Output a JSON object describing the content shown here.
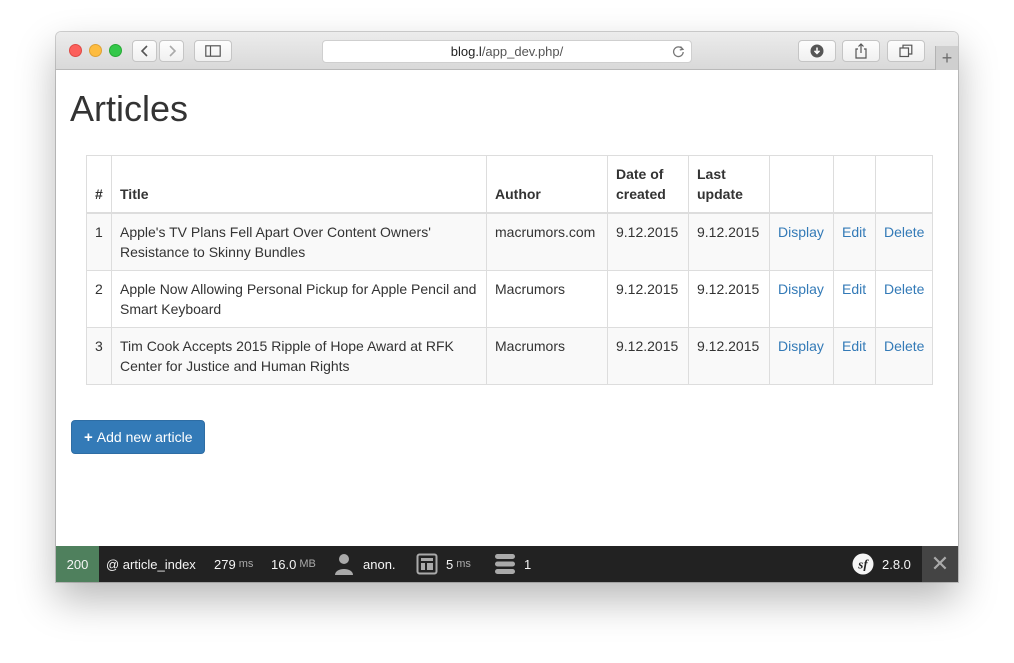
{
  "browser": {
    "url_host": "blog.l",
    "url_path": "/app_dev.php/"
  },
  "page": {
    "title": "Articles"
  },
  "table": {
    "headers": {
      "num": "#",
      "title": "Title",
      "author": "Author",
      "created_1": "Date of",
      "created_2": "created",
      "updated_1": "Last",
      "updated_2": "update"
    },
    "rows": [
      {
        "num": "1",
        "title": "Apple's TV Plans Fell Apart Over Content Owners' Resistance to Skinny Bundles",
        "author": "macrumors.com",
        "created": "9.12.2015",
        "updated": "9.12.2015",
        "display": "Display",
        "edit": "Edit",
        "delete": "Delete"
      },
      {
        "num": "2",
        "title": "Apple Now Allowing Personal Pickup for Apple Pencil and Smart Keyboard",
        "author": "Macrumors",
        "created": "9.12.2015",
        "updated": "9.12.2015",
        "display": "Display",
        "edit": "Edit",
        "delete": "Delete"
      },
      {
        "num": "3",
        "title": "Tim Cook Accepts 2015 Ripple of Hope Award at RFK Center for Justice and Human Rights",
        "author": "Macrumors",
        "created": "9.12.2015",
        "updated": "9.12.2015",
        "display": "Display",
        "edit": "Edit",
        "delete": "Delete"
      }
    ]
  },
  "add_button": {
    "icon": "+",
    "label": "Add new article"
  },
  "toolbar": {
    "status": "200",
    "route": "@ article_index",
    "time_value": "279",
    "time_unit": "ms",
    "memory_value": "16.0",
    "memory_unit": "MB",
    "user": "anon.",
    "render_value": "5",
    "render_unit": "ms",
    "db_queries": "1",
    "version": "2.8.0"
  },
  "colors": {
    "status_ok": "#4f805d",
    "primary": "#337ab7",
    "toolbar_bg": "#222222"
  }
}
